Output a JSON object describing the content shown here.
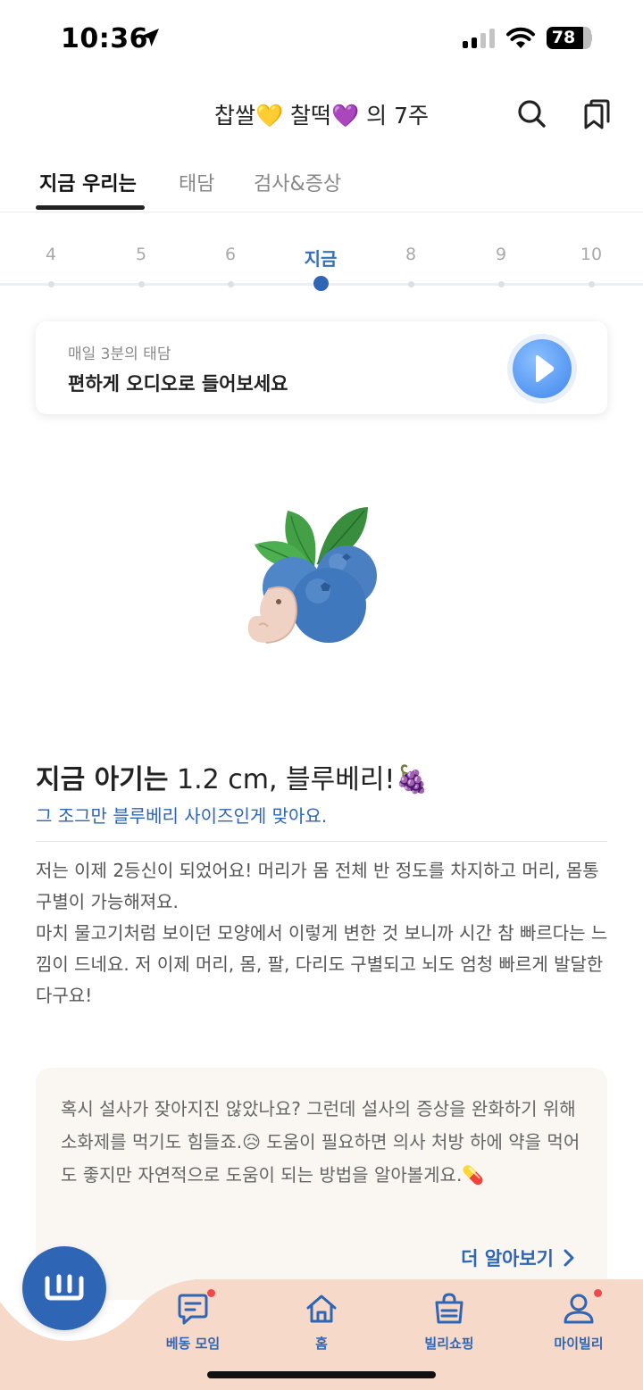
{
  "status_bar": {
    "time": "10:36",
    "battery": "78"
  },
  "header": {
    "title": "찹쌀💛 찰떡💜 의 7주"
  },
  "tabs": [
    {
      "label": "지금 우리는",
      "active": true
    },
    {
      "label": "태담",
      "active": false
    },
    {
      "label": "검사&증상",
      "active": false
    }
  ],
  "weeks": [
    "4",
    "5",
    "6",
    "지금",
    "8",
    "9",
    "10"
  ],
  "audio_card": {
    "subtitle": "매일 3분의 태담",
    "title": "편하게 오디오로 들어보세요"
  },
  "baby": {
    "title_bold": "지금 아기는",
    "title_rest": " 1.2 cm, 블루베리!🍇",
    "subtitle": "그 조그만 블루베리 사이즈인게 맞아요.",
    "description": "저는 이제 2등신이 되었어요! 머리가 몸 전체 반 정도를 차지하고 머리, 몸통 구별이 가능해져요.\n마치 물고기처럼 보이던 모양에서 이렇게 변한 것 보니까 시간 참 빠르다는 느낌이 드네요. 저 이제 머리, 몸, 팔, 다리도 구별되고 뇌도 엄청 빠르게 발달한다구요!"
  },
  "tip": {
    "text": "혹시 설사가 잦아지진 않았나요? 그런데 설사의 증상을 완화하기 위해 소화제를 먹기도 힘들죠.😥 도움이 필요하면 의사 처방 하에 약을 먹어도 좋지만 자연적으로 도움이 되는 방법을 알아볼게요.💊",
    "more_label": "더 알아보기"
  },
  "bottom_nav": [
    {
      "label": "베동 모임",
      "icon": "chat-icon",
      "badge": true
    },
    {
      "label": "홈",
      "icon": "home-icon",
      "badge": false
    },
    {
      "label": "빌리쇼핑",
      "icon": "shopping-bag-icon",
      "badge": false
    },
    {
      "label": "마이빌리",
      "icon": "profile-icon",
      "badge": true
    }
  ],
  "colors": {
    "accent": "#2e66b5",
    "nav_bg": "#f6d9c8",
    "tip_bg": "#faf7f3"
  }
}
